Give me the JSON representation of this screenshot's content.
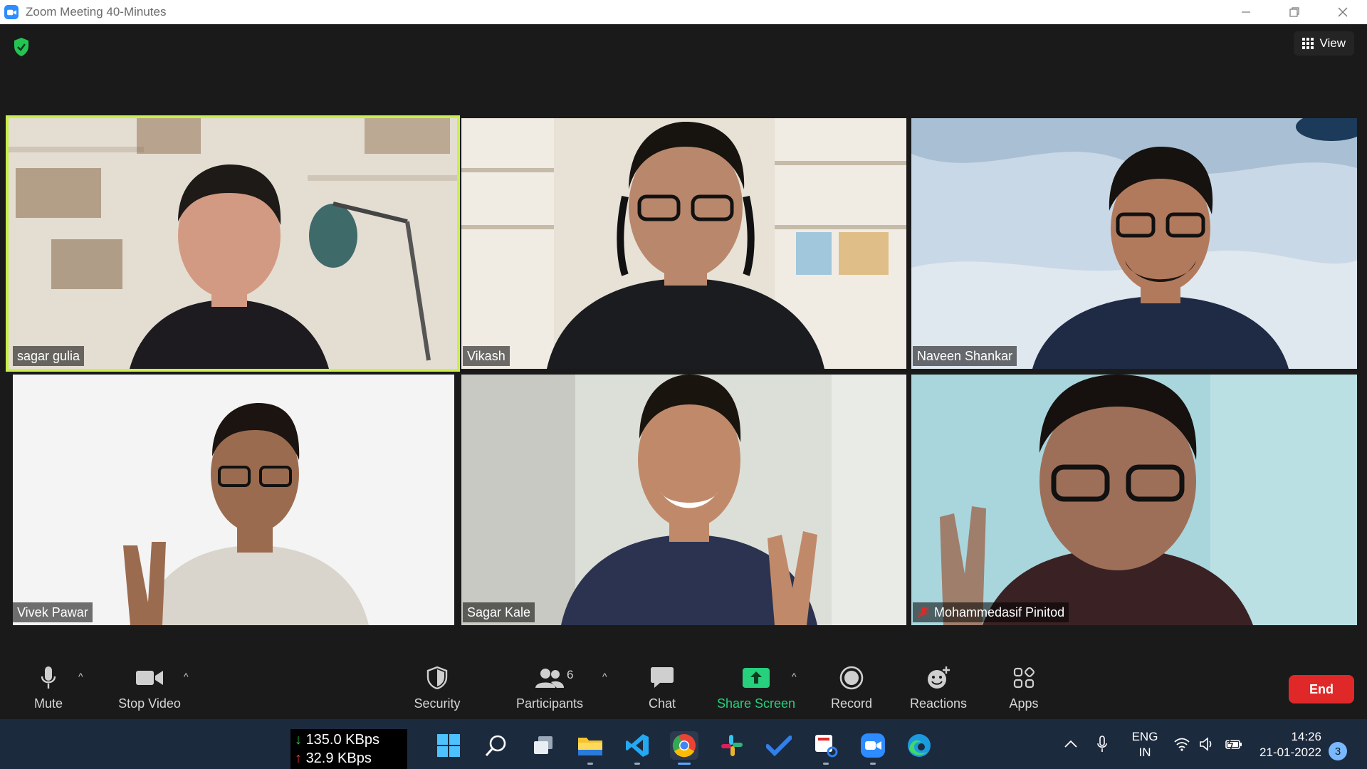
{
  "window": {
    "title": "Zoom Meeting 40-Minutes",
    "view_label": "View"
  },
  "participants": [
    {
      "name": "sagar gulia",
      "active_speaker": true,
      "muted": false,
      "bg": "#e4ddd2",
      "shirt": "#1d1b1f",
      "skin": "#d29a82"
    },
    {
      "name": "Vikash",
      "active_speaker": false,
      "muted": false,
      "bg": "#e7e1d6",
      "shirt": "#1b1c1f",
      "skin": "#b9876b"
    },
    {
      "name": "Naveen Shankar",
      "active_speaker": false,
      "muted": false,
      "bg": "#c9d8e6",
      "shirt": "#1f2a45",
      "skin": "#b27a5c"
    },
    {
      "name": "Vivek Pawar",
      "active_speaker": false,
      "muted": false,
      "bg": "#f4f4f4",
      "shirt": "#d9d4cc",
      "skin": "#9b6b4f"
    },
    {
      "name": "Sagar Kale",
      "active_speaker": false,
      "muted": false,
      "bg": "#dcdfd8",
      "shirt": "#2b3350",
      "skin": "#c08a6a"
    },
    {
      "name": "Mohammedasif Pinitod",
      "active_speaker": false,
      "muted": true,
      "bg": "#a9d6dc",
      "shirt": "#3a2224",
      "skin": "#9e6f58"
    }
  ],
  "toolbar": {
    "mute": "Mute",
    "stop_video": "Stop Video",
    "security": "Security",
    "participants": "Participants",
    "participants_count": "6",
    "chat": "Chat",
    "share_screen": "Share Screen",
    "record": "Record",
    "reactions": "Reactions",
    "apps": "Apps",
    "end": "End"
  },
  "taskbar": {
    "download_speed": "135.0 KBps",
    "upload_speed": "32.9 KBps",
    "lang_line1": "ENG",
    "lang_line2": "IN",
    "time": "14:26",
    "date": "21-01-2022",
    "notification_count": "3",
    "apps": [
      "windows-start",
      "search",
      "task-view",
      "file-explorer",
      "vscode",
      "chrome",
      "slack",
      "todo",
      "snipping-tool",
      "zoom",
      "edge"
    ]
  },
  "colors": {
    "zoom_blue": "#2d8cff",
    "share_green": "#26d07c",
    "end_red": "#e02828",
    "active_speaker_outline": "#c9f04a",
    "security_shield": "#23c552"
  }
}
